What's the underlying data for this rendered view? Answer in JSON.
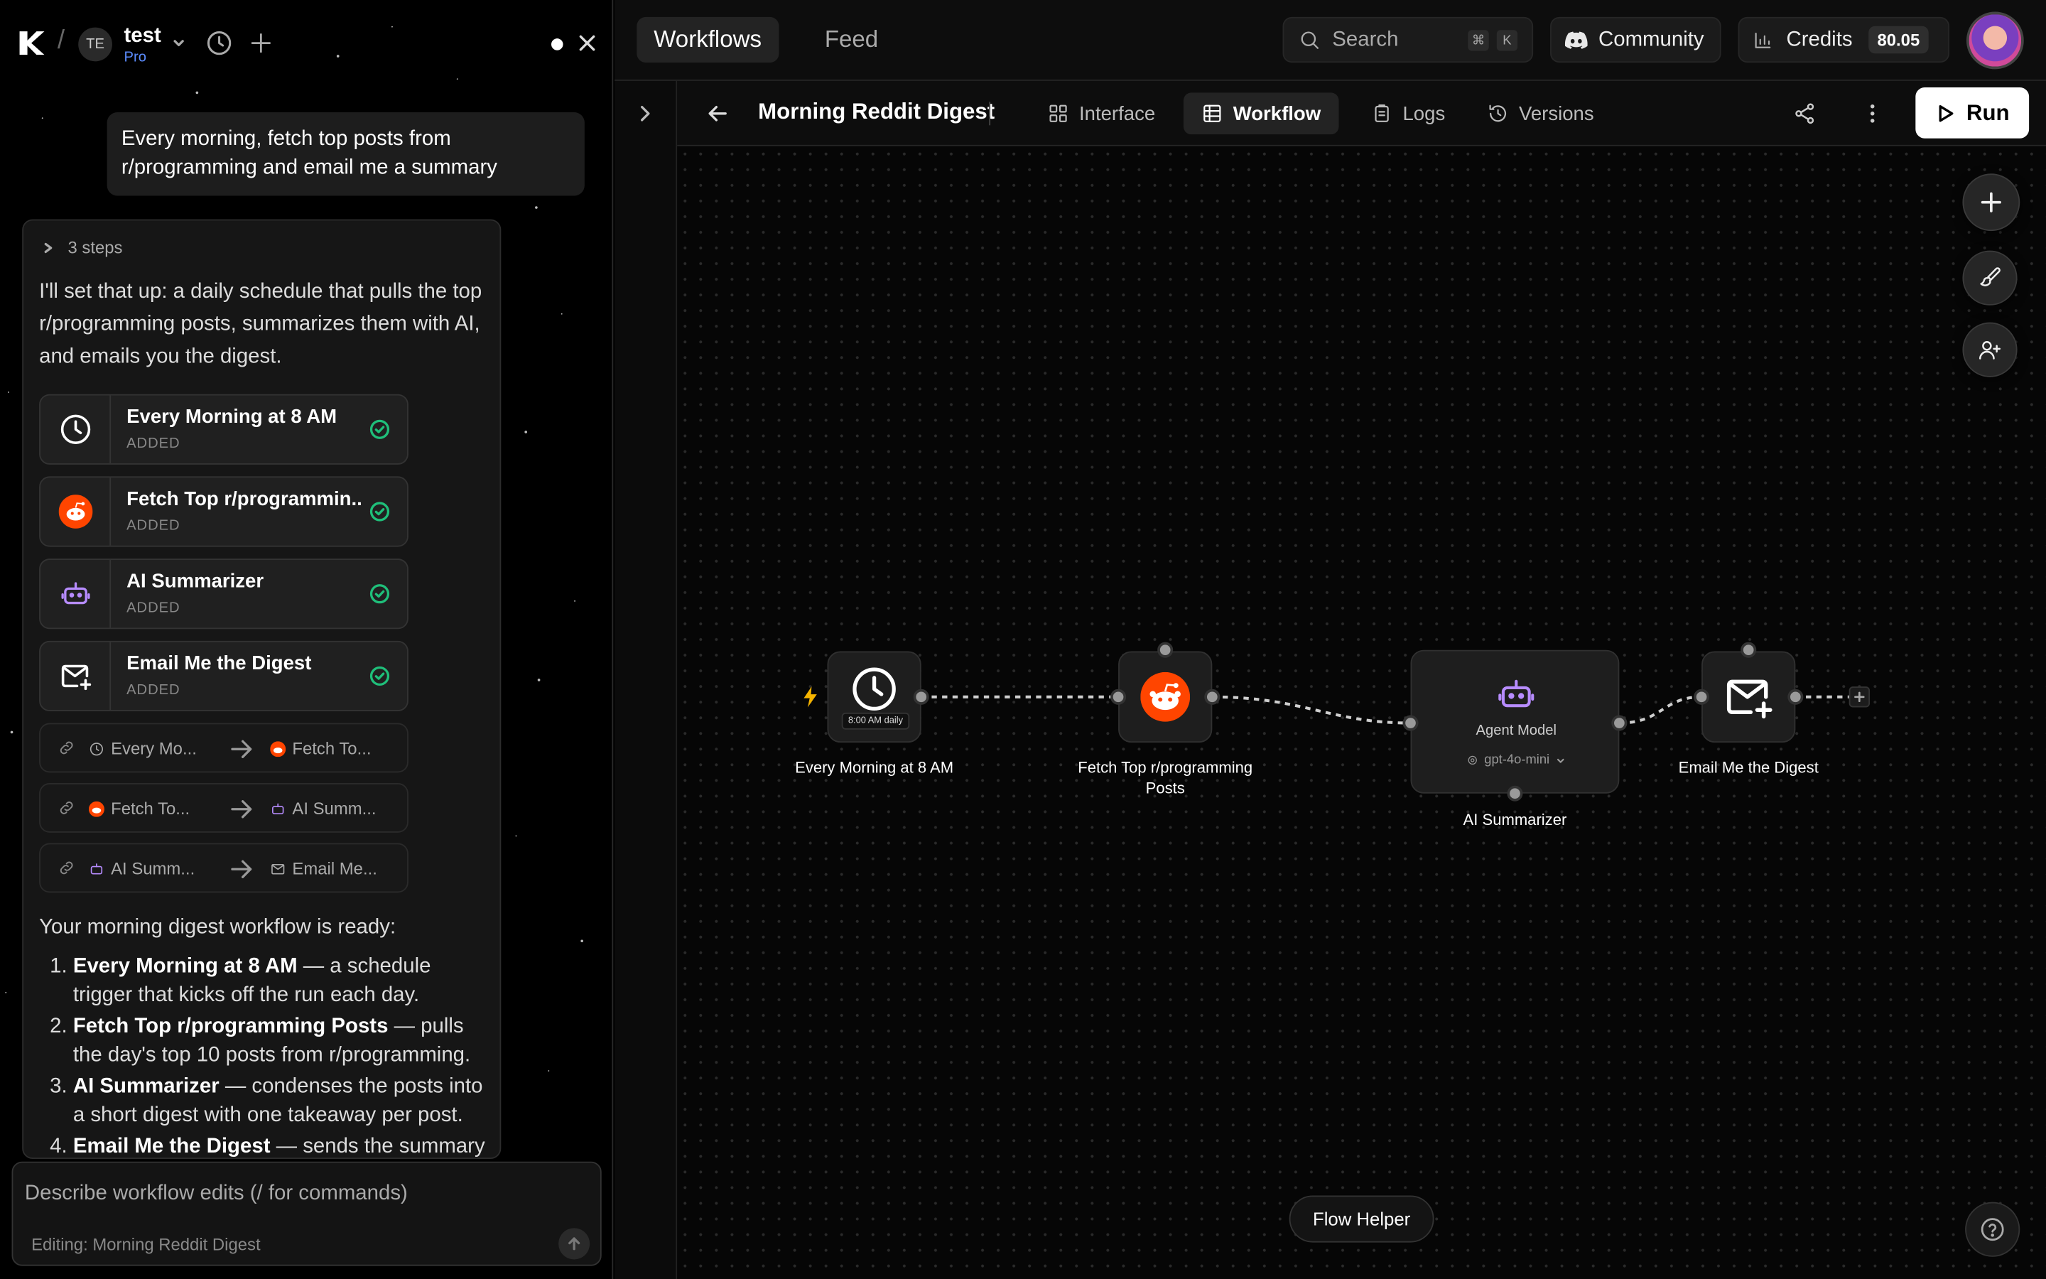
{
  "workspace": {
    "initials": "TE",
    "name": "test",
    "plan": "Pro"
  },
  "chat": {
    "user_message": "Every morning, fetch top posts from r/programming and email me a summary",
    "steps_label": "3 steps",
    "intro": "I'll set that up: a daily schedule that pulls the top r/programming posts, summarizes them with AI, and emails you the digest.",
    "added_nodes": [
      {
        "title": "Every Morning at 8 AM",
        "status": "ADDED",
        "icon": "clock-icon"
      },
      {
        "title": "Fetch Top r/programmin...",
        "status": "ADDED",
        "icon": "reddit-icon"
      },
      {
        "title": "AI Summarizer",
        "status": "ADDED",
        "icon": "robot-icon"
      },
      {
        "title": "Email Me the Digest",
        "status": "ADDED",
        "icon": "mail-plus-icon"
      }
    ],
    "connections": [
      {
        "from": "Every Mo...",
        "to": "Fetch To..."
      },
      {
        "from": "Fetch To...",
        "to": "AI Summ..."
      },
      {
        "from": "AI Summ...",
        "to": "Email Me..."
      }
    ],
    "summary_intro": "Your morning digest workflow is ready:",
    "summary_items": [
      {
        "bold": "Every Morning at 8 AM",
        "text": " — a schedule trigger that kicks off the run each day."
      },
      {
        "bold": "Fetch Top r/programming Posts",
        "text": " — pulls the day's top 10 posts from r/programming."
      },
      {
        "bold": "AI Summarizer",
        "text": " — condenses the posts into a short digest with one takeaway per post."
      },
      {
        "bold": "Email Me the Digest",
        "text": " — sends the summary"
      }
    ],
    "composer": {
      "placeholder": "Describe workflow edits (/ for commands)",
      "editing": "Editing: Morning Reddit Digest"
    }
  },
  "topbar": {
    "tabs": [
      {
        "label": "Workflows",
        "active": true
      },
      {
        "label": "Feed",
        "active": false
      }
    ],
    "search": {
      "label": "Search",
      "shortcut": [
        "⌘",
        "K"
      ]
    },
    "community": "Community",
    "credits": {
      "label": "Credits",
      "value": "80.05"
    }
  },
  "workflow": {
    "title": "Morning Reddit Digest",
    "tabs": [
      {
        "label": "Interface",
        "icon": "grid-icon"
      },
      {
        "label": "Workflow",
        "icon": "table-icon",
        "active": true
      },
      {
        "label": "Logs",
        "icon": "clipboard-icon"
      },
      {
        "label": "Versions",
        "icon": "history-icon"
      }
    ],
    "run_label": "Run"
  },
  "canvas": {
    "nodes": [
      {
        "label": "Every Morning at 8 AM",
        "badge": "8:00 AM daily"
      },
      {
        "label": "Fetch Top r/programming Posts"
      },
      {
        "label": "AI Summarizer",
        "inner_title": "Agent Model",
        "model": "gpt-4o-mini"
      },
      {
        "label": "Email Me the Digest"
      }
    ],
    "flow_helper": "Flow Helper"
  },
  "colors": {
    "reddit": "#ff4500",
    "accent_purple": "#b78cff",
    "success": "#1fbf7a",
    "plan": "#5b8cff"
  }
}
